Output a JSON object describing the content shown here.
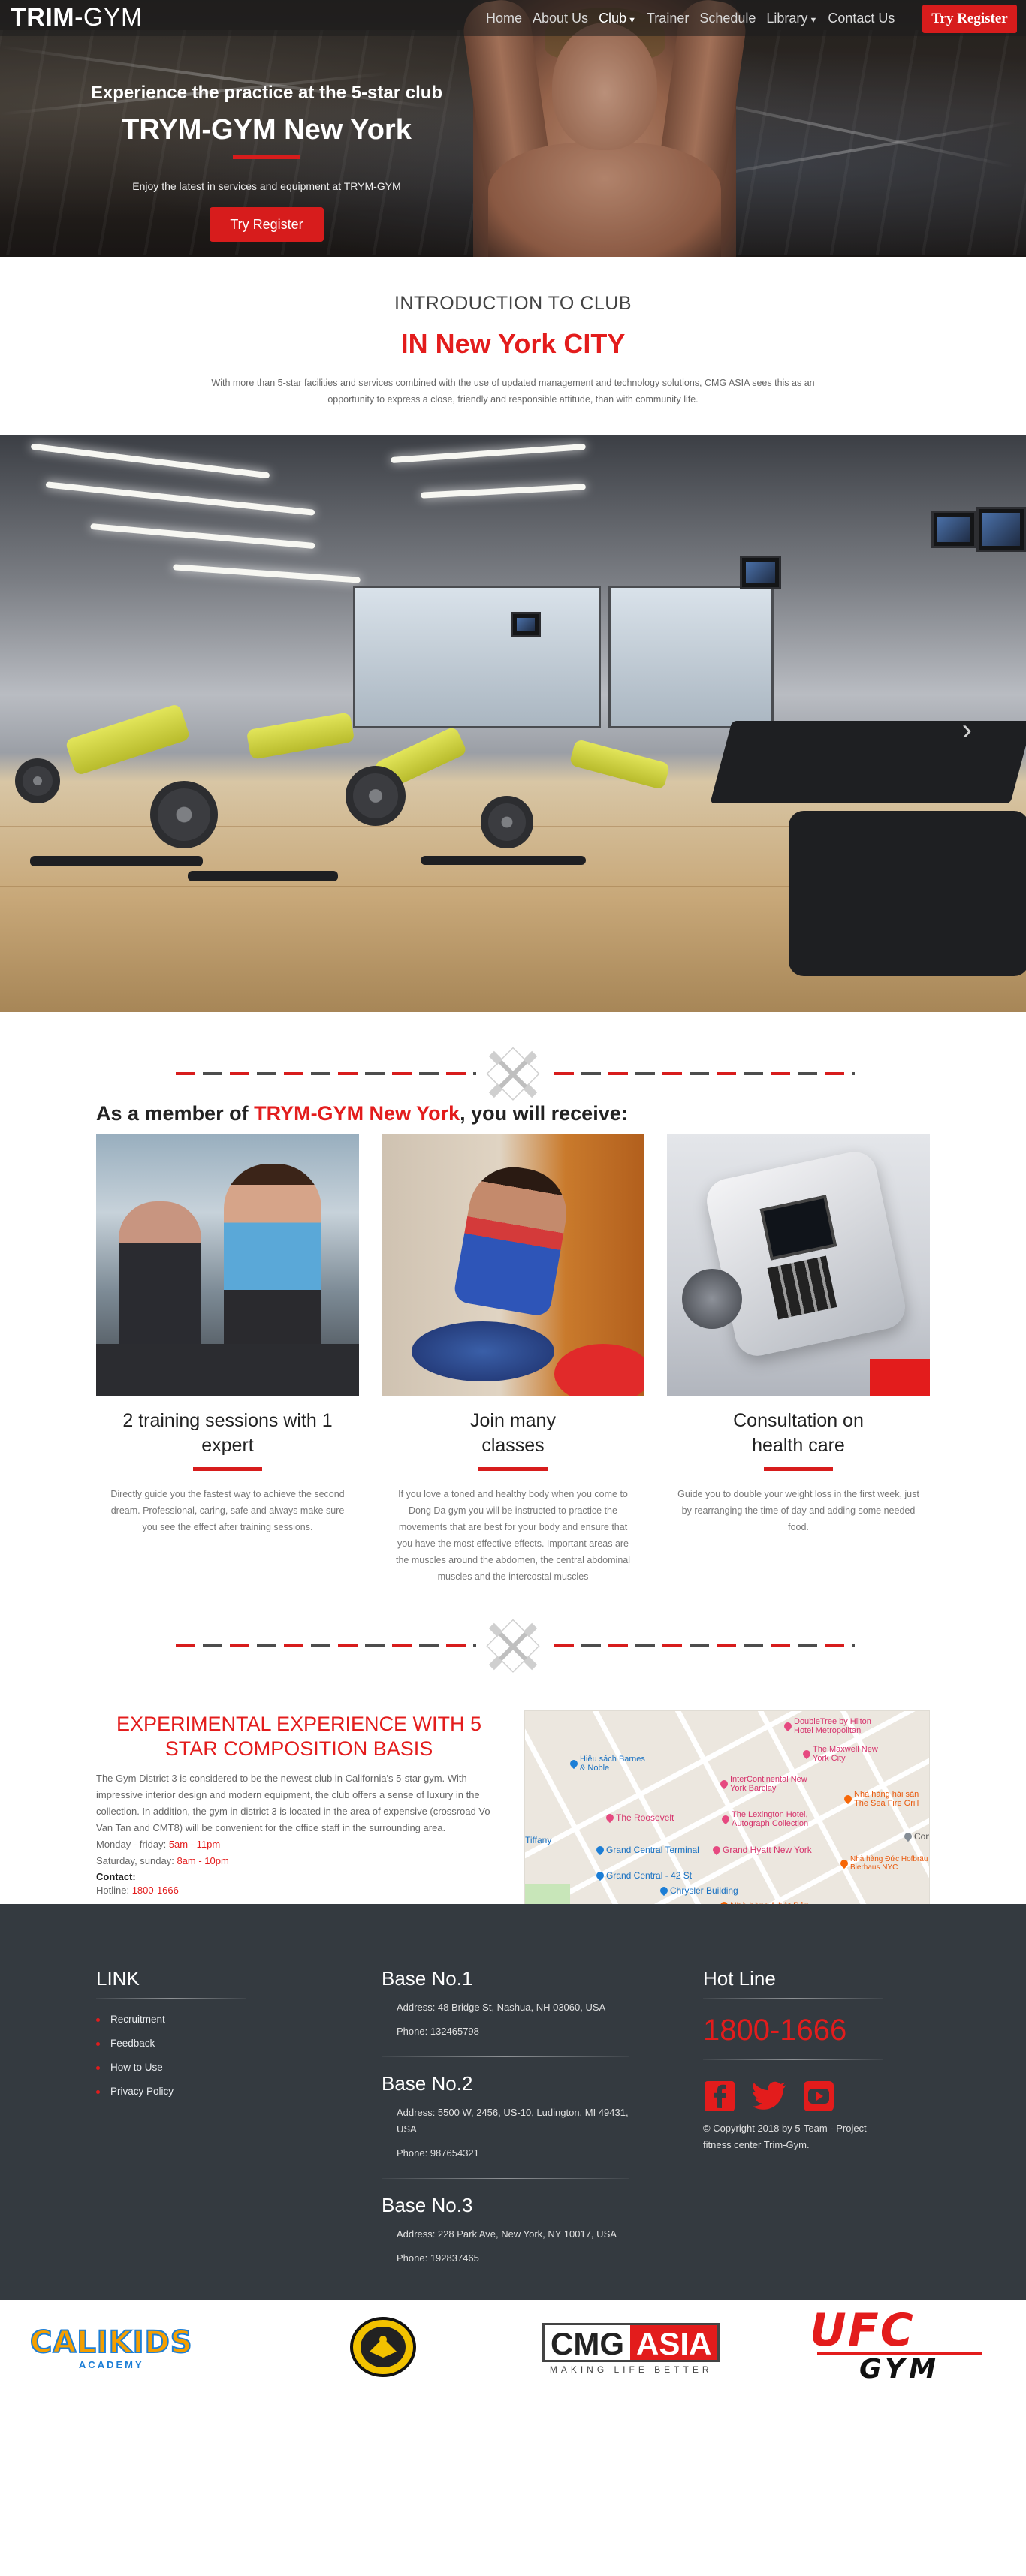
{
  "nav": {
    "brand_bold": "TRIM",
    "brand_light": "-GYM",
    "items": [
      {
        "label": "Home"
      },
      {
        "label": "About Us"
      },
      {
        "label": "Club"
      },
      {
        "label": "Trainer"
      },
      {
        "label": "Schedule"
      },
      {
        "label": "Library"
      },
      {
        "label": "Contact Us"
      }
    ],
    "cta": "Try Register"
  },
  "hero": {
    "subtitle": "Experience the practice at the 5-star club",
    "title": "TRYM-GYM New York",
    "description": "Enjoy the latest in services and equipment at TRYM-GYM",
    "button": "Try Register"
  },
  "intro": {
    "kicker": "INTRODUCTION TO CLUB",
    "title": "IN New York CITY",
    "text": "With more than 5-star facilities and services combined with the use of updated management and technology solutions, CMG ASIA sees this as an opportunity to express a close, friendly and responsible attitude, than with community life."
  },
  "benefits": {
    "heading_pre": "As a member of ",
    "heading_accent": "TRYM-GYM New York",
    "heading_post": ", you will receive:",
    "cards": [
      {
        "title": "2 training sessions with 1 expert",
        "text": "Directly guide you the fastest way to achieve the second dream. Professional, caring, safe and always make sure you see the effect after training sessions."
      },
      {
        "title": "Join many classes",
        "text": "If you love a toned and healthy body when you come to Dong Da gym you will be instructed to practice the movements that are best for your body and ensure that you have the most effective effects. Important areas are the muscles around the abdomen, the central abdominal muscles and the intercostal muscles"
      },
      {
        "title": "Consultation on health care",
        "text": "Guide you to double your weight loss in the first week, just by rearranging the time of day and adding some needed food."
      }
    ]
  },
  "experience": {
    "title": "EXPERIMENTAL EXPERIENCE WITH 5 STAR COMPOSITION BASIS",
    "text": "The Gym District 3 is considered to be the newest club in California's 5-star gym. With impressive interior design and modern equipment, the club offers a sense of luxury in the collection. In addition, the gym in district 3 is located in the area of expensive (crossroad Vo Van Tan and CMT8) will be convenient for the office staff in the surrounding area.",
    "weekday_label": "Monday - friday:",
    "weekday_hours": "5am - 11pm",
    "weekend_label": "Saturday, sunday:",
    "weekend_hours": "8am - 10pm",
    "contact_label": "Contact:",
    "hotline_label": "Hotline:",
    "hotline": "1800-1666"
  },
  "map": {
    "labels": [
      "DoubleTree by Hilton Hotel Metropolitan",
      "The Maxwell New York City",
      "Hiệu sách Barnes & Noble",
      "InterContinental New York Barclay",
      "Nhà hàng hải sản The Sea Fire Grill",
      "The Roosevelt",
      "The Lexington Hotel, Autograph Collection",
      "Grand Central Terminal",
      "Grand Hyatt New York",
      "Nhà hàng Đức Hofbräu Bierhaus NYC",
      "Grand Central - 42 St",
      "Chrysler Building",
      "Nhà hàng Nhật Bản",
      "Consu",
      "Tiffany"
    ]
  },
  "footer": {
    "link_heading": "LINK",
    "links": [
      "Recruitment",
      "Feedback",
      "How to Use",
      "Privacy Policy"
    ],
    "bases": [
      {
        "name": "Base No.1",
        "address": "Address: 48 Bridge St, Nashua, NH 03060, USA",
        "phone": "Phone: 132465798"
      },
      {
        "name": "Base No.2",
        "address": "Address: 5500 W, 2456, US-10, Ludington, MI 49431, USA",
        "phone": "Phone: 987654321"
      },
      {
        "name": "Base No.3",
        "address": "Address: 228 Park Ave, New York, NY 10017, USA",
        "phone": "Phone: 192837465"
      }
    ],
    "hotline_heading": "Hot Line",
    "hotline": "1800-1666",
    "copyright": "© Copyright 2018 by 5-Team - Project fitness center Trim-Gym."
  },
  "partners": {
    "calikids": "CALIKIDS",
    "calikids_sub": "ACADEMY",
    "cmg_left": "CMG",
    "cmg_right": "ASIA",
    "cmg_tag": "MAKING LIFE BETTER",
    "ufc": "UFC",
    "ufc_sub": "GYM"
  },
  "colors": {
    "accent": "#e31c1c",
    "footer_bg": "#343a40"
  }
}
